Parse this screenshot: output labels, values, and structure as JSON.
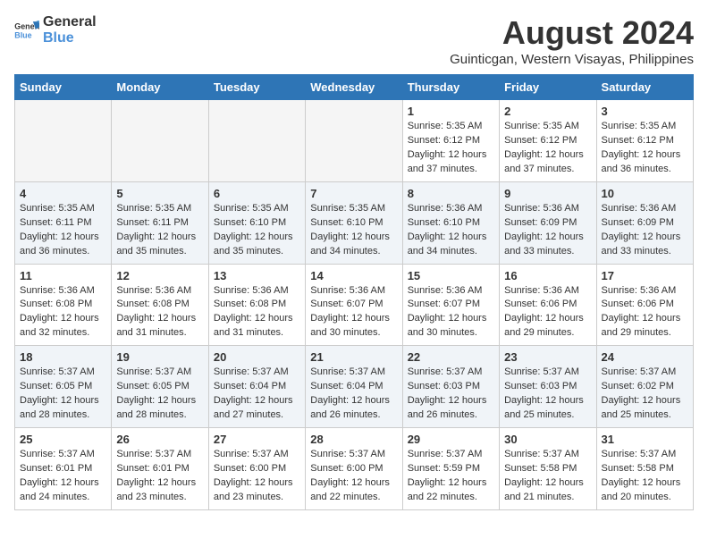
{
  "header": {
    "logo_general": "General",
    "logo_blue": "Blue",
    "month_year": "August 2024",
    "location": "Guinticgan, Western Visayas, Philippines"
  },
  "weekdays": [
    "Sunday",
    "Monday",
    "Tuesday",
    "Wednesday",
    "Thursday",
    "Friday",
    "Saturday"
  ],
  "weeks": [
    [
      {
        "day": "",
        "info": ""
      },
      {
        "day": "",
        "info": ""
      },
      {
        "day": "",
        "info": ""
      },
      {
        "day": "",
        "info": ""
      },
      {
        "day": "1",
        "info": "Sunrise: 5:35 AM\nSunset: 6:12 PM\nDaylight: 12 hours\nand 37 minutes."
      },
      {
        "day": "2",
        "info": "Sunrise: 5:35 AM\nSunset: 6:12 PM\nDaylight: 12 hours\nand 37 minutes."
      },
      {
        "day": "3",
        "info": "Sunrise: 5:35 AM\nSunset: 6:12 PM\nDaylight: 12 hours\nand 36 minutes."
      }
    ],
    [
      {
        "day": "4",
        "info": "Sunrise: 5:35 AM\nSunset: 6:11 PM\nDaylight: 12 hours\nand 36 minutes."
      },
      {
        "day": "5",
        "info": "Sunrise: 5:35 AM\nSunset: 6:11 PM\nDaylight: 12 hours\nand 35 minutes."
      },
      {
        "day": "6",
        "info": "Sunrise: 5:35 AM\nSunset: 6:10 PM\nDaylight: 12 hours\nand 35 minutes."
      },
      {
        "day": "7",
        "info": "Sunrise: 5:35 AM\nSunset: 6:10 PM\nDaylight: 12 hours\nand 34 minutes."
      },
      {
        "day": "8",
        "info": "Sunrise: 5:36 AM\nSunset: 6:10 PM\nDaylight: 12 hours\nand 34 minutes."
      },
      {
        "day": "9",
        "info": "Sunrise: 5:36 AM\nSunset: 6:09 PM\nDaylight: 12 hours\nand 33 minutes."
      },
      {
        "day": "10",
        "info": "Sunrise: 5:36 AM\nSunset: 6:09 PM\nDaylight: 12 hours\nand 33 minutes."
      }
    ],
    [
      {
        "day": "11",
        "info": "Sunrise: 5:36 AM\nSunset: 6:08 PM\nDaylight: 12 hours\nand 32 minutes."
      },
      {
        "day": "12",
        "info": "Sunrise: 5:36 AM\nSunset: 6:08 PM\nDaylight: 12 hours\nand 31 minutes."
      },
      {
        "day": "13",
        "info": "Sunrise: 5:36 AM\nSunset: 6:08 PM\nDaylight: 12 hours\nand 31 minutes."
      },
      {
        "day": "14",
        "info": "Sunrise: 5:36 AM\nSunset: 6:07 PM\nDaylight: 12 hours\nand 30 minutes."
      },
      {
        "day": "15",
        "info": "Sunrise: 5:36 AM\nSunset: 6:07 PM\nDaylight: 12 hours\nand 30 minutes."
      },
      {
        "day": "16",
        "info": "Sunrise: 5:36 AM\nSunset: 6:06 PM\nDaylight: 12 hours\nand 29 minutes."
      },
      {
        "day": "17",
        "info": "Sunrise: 5:36 AM\nSunset: 6:06 PM\nDaylight: 12 hours\nand 29 minutes."
      }
    ],
    [
      {
        "day": "18",
        "info": "Sunrise: 5:37 AM\nSunset: 6:05 PM\nDaylight: 12 hours\nand 28 minutes."
      },
      {
        "day": "19",
        "info": "Sunrise: 5:37 AM\nSunset: 6:05 PM\nDaylight: 12 hours\nand 28 minutes."
      },
      {
        "day": "20",
        "info": "Sunrise: 5:37 AM\nSunset: 6:04 PM\nDaylight: 12 hours\nand 27 minutes."
      },
      {
        "day": "21",
        "info": "Sunrise: 5:37 AM\nSunset: 6:04 PM\nDaylight: 12 hours\nand 26 minutes."
      },
      {
        "day": "22",
        "info": "Sunrise: 5:37 AM\nSunset: 6:03 PM\nDaylight: 12 hours\nand 26 minutes."
      },
      {
        "day": "23",
        "info": "Sunrise: 5:37 AM\nSunset: 6:03 PM\nDaylight: 12 hours\nand 25 minutes."
      },
      {
        "day": "24",
        "info": "Sunrise: 5:37 AM\nSunset: 6:02 PM\nDaylight: 12 hours\nand 25 minutes."
      }
    ],
    [
      {
        "day": "25",
        "info": "Sunrise: 5:37 AM\nSunset: 6:01 PM\nDaylight: 12 hours\nand 24 minutes."
      },
      {
        "day": "26",
        "info": "Sunrise: 5:37 AM\nSunset: 6:01 PM\nDaylight: 12 hours\nand 23 minutes."
      },
      {
        "day": "27",
        "info": "Sunrise: 5:37 AM\nSunset: 6:00 PM\nDaylight: 12 hours\nand 23 minutes."
      },
      {
        "day": "28",
        "info": "Sunrise: 5:37 AM\nSunset: 6:00 PM\nDaylight: 12 hours\nand 22 minutes."
      },
      {
        "day": "29",
        "info": "Sunrise: 5:37 AM\nSunset: 5:59 PM\nDaylight: 12 hours\nand 22 minutes."
      },
      {
        "day": "30",
        "info": "Sunrise: 5:37 AM\nSunset: 5:58 PM\nDaylight: 12 hours\nand 21 minutes."
      },
      {
        "day": "31",
        "info": "Sunrise: 5:37 AM\nSunset: 5:58 PM\nDaylight: 12 hours\nand 20 minutes."
      }
    ]
  ]
}
